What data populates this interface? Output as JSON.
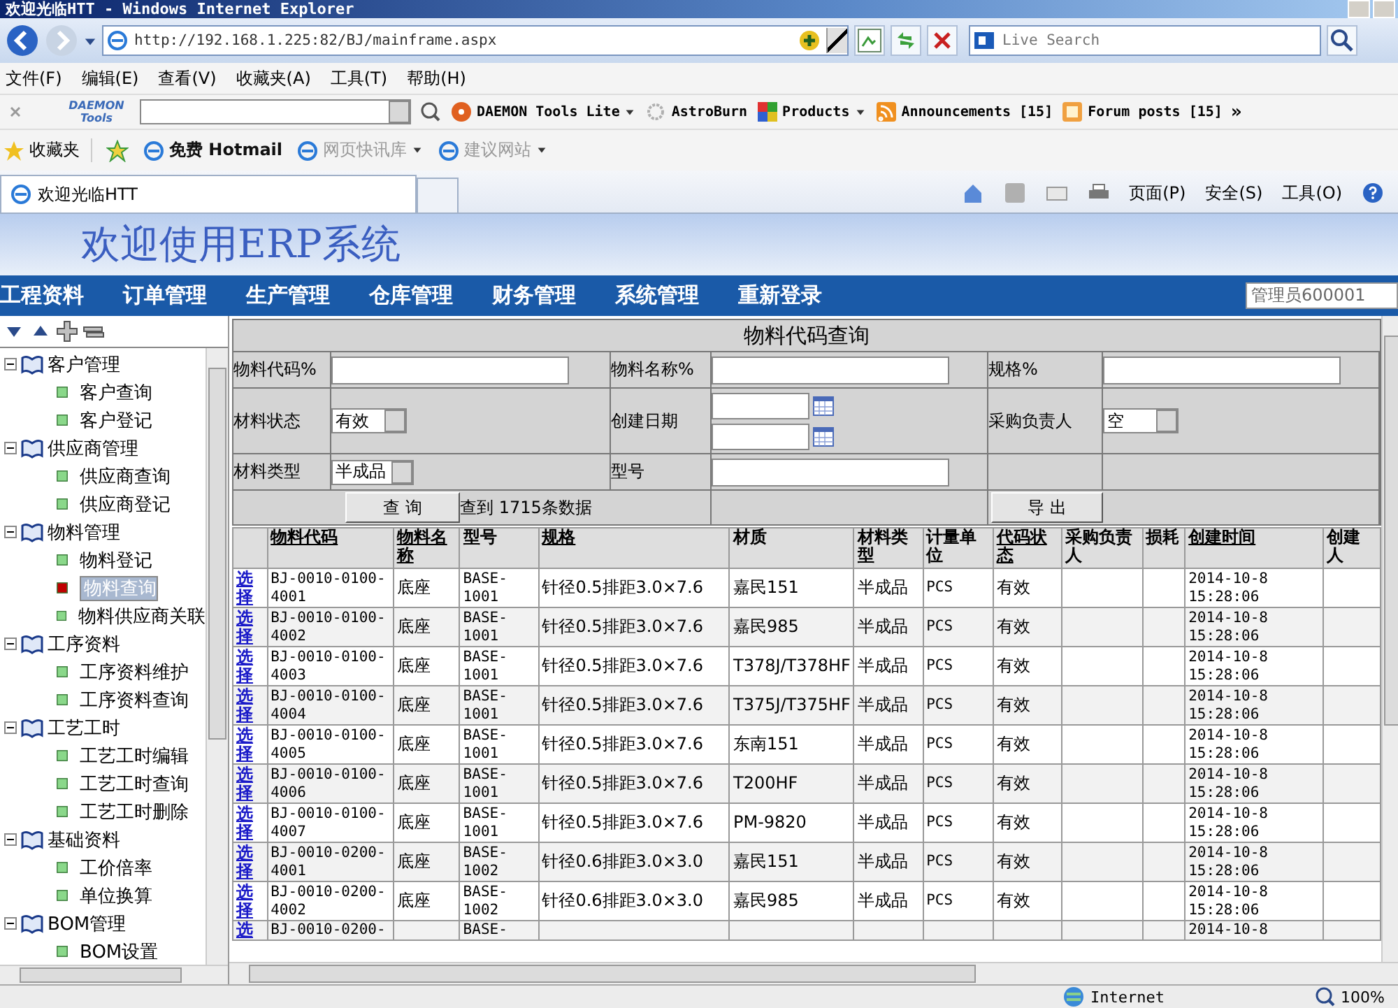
{
  "window": {
    "title": "欢迎光临HTT - Windows Internet Explorer"
  },
  "address_bar": {
    "url": "http://192.168.1.225:82/BJ/mainframe.aspx"
  },
  "search": {
    "placeholder": "Live Search"
  },
  "menu": [
    "文件(F)",
    "编辑(E)",
    "查看(V)",
    "收藏夹(A)",
    "工具(T)",
    "帮助(H)"
  ],
  "toolbar": {
    "logo": "DAEMON Tools",
    "more": "»",
    "items": [
      {
        "label": "DAEMON Tools Lite",
        "kind": "disc",
        "menu": true
      },
      {
        "label": "AstroBurn",
        "kind": "burn",
        "menu": false
      },
      {
        "label": "Products",
        "kind": "products",
        "menu": true
      },
      {
        "label": "Announcements [15]",
        "kind": "rss",
        "menu": false
      },
      {
        "label": "Forum posts [15]",
        "kind": "forum",
        "menu": false
      }
    ]
  },
  "favorites": {
    "label": "收藏夹",
    "items": [
      {
        "label": "免费 Hotmail",
        "dimmed": false,
        "menu": false
      },
      {
        "label": "网页快讯库",
        "dimmed": true,
        "menu": true
      },
      {
        "label": "建议网站",
        "dimmed": true,
        "menu": true
      }
    ]
  },
  "tab": {
    "title": "欢迎光临HTT"
  },
  "command_bar": [
    "页面(P)",
    "安全(S)",
    "工具(O)"
  ],
  "erp": {
    "title": "欢迎使用ERP系统",
    "user": "管理员600001",
    "nav": [
      "工程资料",
      "订单管理",
      "生产管理",
      "仓库管理",
      "财务管理",
      "系统管理",
      "重新登录"
    ]
  },
  "sidebar": {
    "tree": [
      {
        "label": "客户管理",
        "expanded": true,
        "children": [
          {
            "label": "客户查询",
            "selected": false
          },
          {
            "label": "客户登记",
            "selected": false
          }
        ]
      },
      {
        "label": "供应商管理",
        "expanded": true,
        "children": [
          {
            "label": "供应商查询",
            "selected": false
          },
          {
            "label": "供应商登记",
            "selected": false
          }
        ]
      },
      {
        "label": "物料管理",
        "expanded": true,
        "children": [
          {
            "label": "物料登记",
            "selected": false
          },
          {
            "label": "物料查询",
            "selected": true
          },
          {
            "label": "物料供应商关联",
            "selected": false
          }
        ]
      },
      {
        "label": "工序资料",
        "expanded": true,
        "children": [
          {
            "label": "工序资料维护",
            "selected": false
          },
          {
            "label": "工序资料查询",
            "selected": false
          }
        ]
      },
      {
        "label": "工艺工时",
        "expanded": true,
        "children": [
          {
            "label": "工艺工时编辑",
            "selected": false
          },
          {
            "label": "工艺工时查询",
            "selected": false
          },
          {
            "label": "工艺工时删除",
            "selected": false
          }
        ]
      },
      {
        "label": "基础资料",
        "expanded": true,
        "children": [
          {
            "label": "工价倍率",
            "selected": false
          },
          {
            "label": "单位换算",
            "selected": false
          }
        ]
      },
      {
        "label": "BOM管理",
        "expanded": true,
        "children": [
          {
            "label": "BOM设置",
            "selected": false
          }
        ]
      }
    ]
  },
  "query": {
    "title": "物料代码查询",
    "fields": [
      {
        "label": "物料代码%",
        "kind": "text"
      },
      {
        "label": "物料名称%",
        "kind": "text"
      },
      {
        "label": "规格%",
        "kind": "text"
      },
      {
        "label": "材料状态",
        "kind": "select",
        "value": "有效"
      },
      {
        "label": "创建日期",
        "kind": "date_range"
      },
      {
        "label": "采购负责人",
        "kind": "select",
        "value": "空"
      },
      {
        "label": "材料类型",
        "kind": "select",
        "value": "半成品"
      },
      {
        "label": "型号",
        "kind": "text"
      }
    ],
    "search_button": "查 询",
    "result": "查到 1715条数据",
    "export_button": "导 出"
  },
  "table": {
    "columns": [
      {
        "label": "物料代码",
        "sortable": true
      },
      {
        "label": "物料名称",
        "sortable": true
      },
      {
        "label": "型号",
        "sortable": false
      },
      {
        "label": "规格",
        "sortable": true
      },
      {
        "label": "材质",
        "sortable": false
      },
      {
        "label": "材料类型",
        "sortable": false
      },
      {
        "label": "计量单位",
        "sortable": false
      },
      {
        "label": "代码状态",
        "sortable": true
      },
      {
        "label": "采购负责人",
        "sortable": false
      },
      {
        "label": "损耗",
        "sortable": false
      },
      {
        "label": "创建时间",
        "sortable": true
      },
      {
        "label": "创建人",
        "sortable": false
      }
    ],
    "rows": [
      {
        "action": "选择",
        "cells": [
          "BJ-0010-0100-4001",
          "底座",
          "BASE-1001",
          "针径0.5排距3.0×7.6",
          "嘉民151",
          "半成品",
          "PCS",
          "有效",
          null,
          null,
          "2014-10-8 15:28:06",
          null
        ]
      },
      {
        "action": "选择",
        "cells": [
          "BJ-0010-0100-4002",
          "底座",
          "BASE-1001",
          "针径0.5排距3.0×7.6",
          "嘉民985",
          "半成品",
          "PCS",
          "有效",
          null,
          null,
          "2014-10-8 15:28:06",
          null
        ]
      },
      {
        "action": "选择",
        "cells": [
          "BJ-0010-0100-4003",
          "底座",
          "BASE-1001",
          "针径0.5排距3.0×7.6",
          "T378J/T378HF",
          "半成品",
          "PCS",
          "有效",
          null,
          null,
          "2014-10-8 15:28:06",
          null
        ]
      },
      {
        "action": "选择",
        "cells": [
          "BJ-0010-0100-4004",
          "底座",
          "BASE-1001",
          "针径0.5排距3.0×7.6",
          "T375J/T375HF",
          "半成品",
          "PCS",
          "有效",
          null,
          null,
          "2014-10-8 15:28:06",
          null
        ]
      },
      {
        "action": "选择",
        "cells": [
          "BJ-0010-0100-4005",
          "底座",
          "BASE-1001",
          "针径0.5排距3.0×7.6",
          "东南151",
          "半成品",
          "PCS",
          "有效",
          null,
          null,
          "2014-10-8 15:28:06",
          null
        ]
      },
      {
        "action": "选择",
        "cells": [
          "BJ-0010-0100-4006",
          "底座",
          "BASE-1001",
          "针径0.5排距3.0×7.6",
          "T200HF",
          "半成品",
          "PCS",
          "有效",
          null,
          null,
          "2014-10-8 15:28:06",
          null
        ]
      },
      {
        "action": "选择",
        "cells": [
          "BJ-0010-0100-4007",
          "底座",
          "BASE-1001",
          "针径0.5排距3.0×7.6",
          "PM-9820",
          "半成品",
          "PCS",
          "有效",
          null,
          null,
          "2014-10-8 15:28:06",
          null
        ]
      },
      {
        "action": "选择",
        "cells": [
          "BJ-0010-0200-4001",
          "底座",
          "BASE-1002",
          "针径0.6排距3.0×3.0",
          "嘉民151",
          "半成品",
          "PCS",
          "有效",
          null,
          null,
          "2014-10-8 15:28:06",
          null
        ]
      },
      {
        "action": "选择",
        "cells": [
          "BJ-0010-0200-4002",
          "底座",
          "BASE-1002",
          "针径0.6排距3.0×3.0",
          "嘉民985",
          "半成品",
          "PCS",
          "有效",
          null,
          null,
          "2014-10-8 15:28:06",
          null
        ]
      },
      {
        "action": "选",
        "cells": [
          "BJ-0010-0200-",
          null,
          "BASE-",
          null,
          null,
          null,
          null,
          null,
          null,
          null,
          "2014-10-8",
          null
        ]
      }
    ]
  },
  "status_bar": {
    "zone": "Internet",
    "zoom": "100%"
  }
}
